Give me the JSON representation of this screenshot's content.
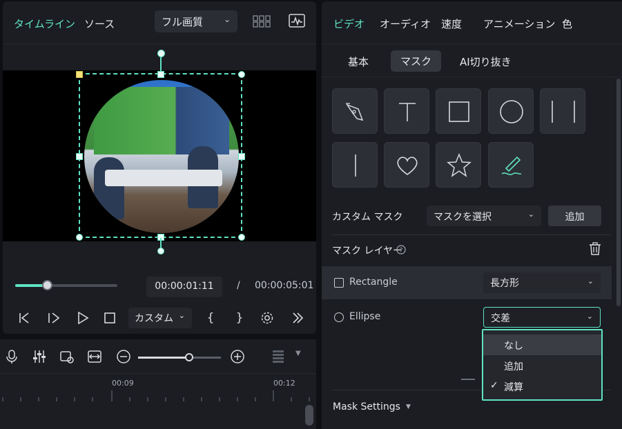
{
  "preview": {
    "tabs": [
      "タイムライン",
      "ソース"
    ],
    "quality": "フル画質",
    "current_time": "00:00:01:11",
    "separator": "/",
    "total_time": "00:00:05:01",
    "speed_select": "カスタム",
    "progress": 0.27
  },
  "timeline": {
    "ticks": [
      "00:09",
      "00:12"
    ],
    "zoom": 0.62
  },
  "right": {
    "tabs": [
      "ビデオ",
      "オーディオ",
      "速度",
      "アニメーション",
      "色"
    ],
    "subtabs": [
      "基本",
      "マスク",
      "AI切り抜き"
    ],
    "mask_shapes": [
      "pen-mask-icon",
      "text-mask-icon",
      "rectangle-mask-icon",
      "circle-mask-icon",
      "double-line-mask-icon",
      "single-line-mask-icon",
      "heart-mask-icon",
      "star-mask-icon",
      "brush-mask-icon"
    ],
    "custom_mask_label": "カスタム マスク",
    "custom_mask_select": "マスクを選択",
    "add_label": "追加",
    "mask_layer_label": "マスク レイヤー",
    "layers": [
      {
        "name": "Rectangle",
        "mode": "長方形"
      },
      {
        "name": "Ellipse",
        "mode": "交差"
      }
    ],
    "dropdown_options": [
      "なし",
      "追加",
      "減算"
    ],
    "mask_settings_label": "Mask Settings",
    "accent": "#5fe3c4"
  }
}
